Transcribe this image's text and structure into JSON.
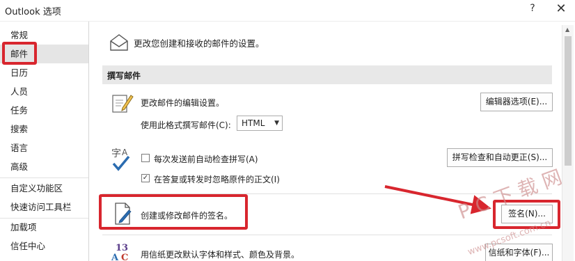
{
  "window": {
    "title": "Outlook 选项",
    "help": "?",
    "close": "✕"
  },
  "sidebar": {
    "items": [
      {
        "label": "常规"
      },
      {
        "label": "邮件"
      },
      {
        "label": "日历"
      },
      {
        "label": "人员"
      },
      {
        "label": "任务"
      },
      {
        "label": "搜索"
      },
      {
        "label": "语言"
      },
      {
        "label": "高级"
      },
      {
        "label": "自定义功能区"
      },
      {
        "label": "快速访问工具栏"
      },
      {
        "label": "加载项"
      },
      {
        "label": "信任中心"
      }
    ],
    "selected": "邮件"
  },
  "main": {
    "intro": "更改您创建和接收的邮件的设置。",
    "compose": {
      "header": "撰写邮件",
      "editor_text": "更改邮件的编辑设置。",
      "editor_button": "编辑器选项(E)...",
      "format_label": "使用此格式撰写邮件(C):",
      "format_value": "HTML",
      "spell_check_label": "每次发送前自动检查拼写(A)",
      "ignore_original_label": "在答复或转发时忽略原件的正文(I)",
      "spelling_button": "拼写检查和自动更正(S)...",
      "signature_text": "创建或修改邮件的签名。",
      "signature_button": "签名(N)...",
      "stationery_text": "用信纸更改默认字体和样式、颜色及背景。",
      "stationery_button": "信纸和字体(F)..."
    }
  },
  "checkboxes": {
    "spell_check": false,
    "ignore_original": true
  },
  "watermark": {
    "brand": "P C 下 载 网",
    "url": "www.pcsoft.com.cn"
  },
  "colors": {
    "highlight_red": "#d8262e",
    "selected_bg": "#e5e5e5",
    "section_bg": "#e8e8e8",
    "icon_blue": "#2b6cb0"
  }
}
